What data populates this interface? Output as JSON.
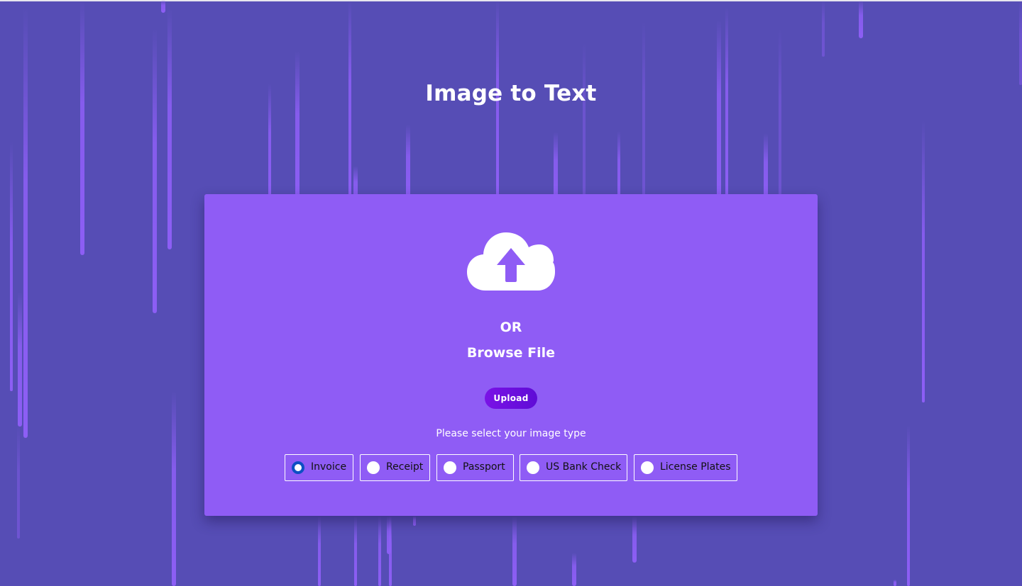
{
  "page": {
    "title": "Image to Text"
  },
  "uploader": {
    "icon": "cloud-upload-icon",
    "or_label": "OR",
    "browse_label": "Browse File",
    "upload_button_label": "Upload"
  },
  "image_type": {
    "prompt": "Please select your image type",
    "selected": "Invoice",
    "options": [
      {
        "label": "Invoice",
        "checked": true
      },
      {
        "label": "Receipt",
        "checked": false
      },
      {
        "label": "Passport",
        "checked": false
      },
      {
        "label": "US Bank Check",
        "checked": false
      },
      {
        "label": "License Plates",
        "checked": false
      }
    ]
  },
  "colors": {
    "background": "#564db5",
    "streak": "#8d5ef5",
    "card": "#8f5cf5",
    "upload_button": "#6a0ee0",
    "radio_checked": "#0d4fc4"
  }
}
